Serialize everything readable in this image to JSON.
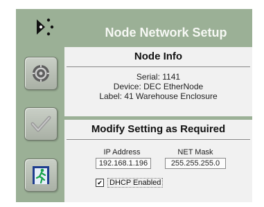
{
  "app": {
    "title": "Node Network Setup",
    "accent_color": "#9bb096"
  },
  "sidebar": {
    "buttons": [
      {
        "icon": "gear-icon"
      },
      {
        "icon": "checkmark-icon"
      },
      {
        "icon": "exit-door-icon"
      }
    ]
  },
  "node_info": {
    "title": "Node Info",
    "serial": "Serial: 1141",
    "device": "Device: DEC EtherNode",
    "label": "Label: 41 Warehouse Enclosure"
  },
  "modify": {
    "title": "Modify Setting as Required",
    "ip_label": "IP Address",
    "ip_value": "192.168.1.196",
    "mask_label": "NET Mask",
    "mask_value": "255.255.255.0",
    "dhcp_label": "DHCP Enabled",
    "dhcp_checked": true,
    "dhcp_check_glyph": "✔"
  }
}
